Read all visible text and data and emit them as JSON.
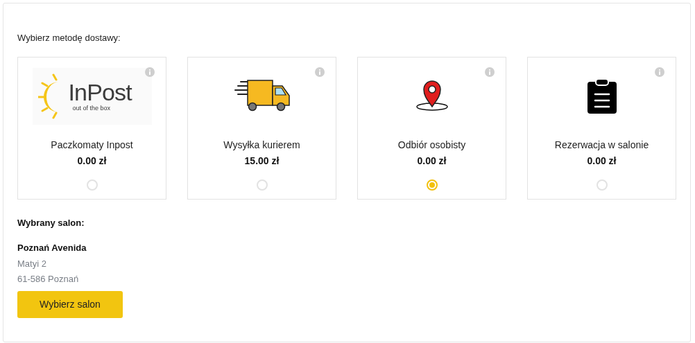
{
  "heading": "Wybierz metodę dostawy:",
  "options": [
    {
      "kind": "inpost",
      "logo_name": "InPost",
      "logo_tagline": "out of the box",
      "name": "Paczkomaty Inpost",
      "price": "0.00 zł",
      "selected": false
    },
    {
      "kind": "truck",
      "name": "Wysyłka kurierem",
      "price": "15.00 zł",
      "selected": false
    },
    {
      "kind": "pin",
      "name": "Odbiór osobisty",
      "price": "0.00 zł",
      "selected": true
    },
    {
      "kind": "clipboard",
      "name": "Rezerwacja w salonie",
      "price": "0.00 zł",
      "selected": false
    }
  ],
  "salon": {
    "label": "Wybrany salon:",
    "name": "Poznań Avenida",
    "street": "Matyi 2",
    "city": "61-586 Poznań",
    "button": "Wybierz salon"
  }
}
